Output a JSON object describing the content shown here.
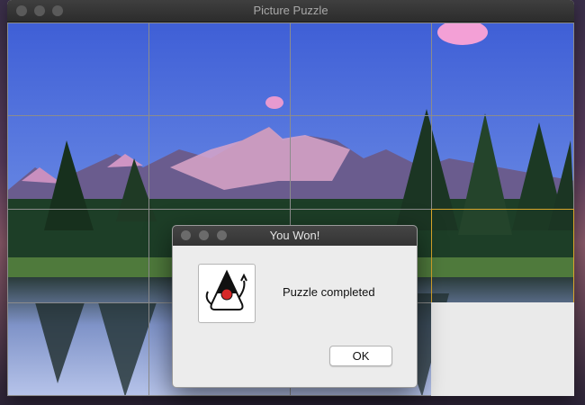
{
  "window": {
    "title": "Picture Puzzle"
  },
  "dialog": {
    "title": "You Won!",
    "message": "Puzzle completed",
    "ok_label": "OK",
    "icon": "java-duke-icon"
  },
  "puzzle": {
    "rows": 4,
    "cols": 4,
    "selected_tile": {
      "row": 2,
      "col": 3
    },
    "empty_tile": {
      "row": 3,
      "col": 3
    }
  },
  "colors": {
    "selection": "#d9a62b",
    "window_bg": "#e9e9e9",
    "titlebar": "#2c2c2c"
  }
}
